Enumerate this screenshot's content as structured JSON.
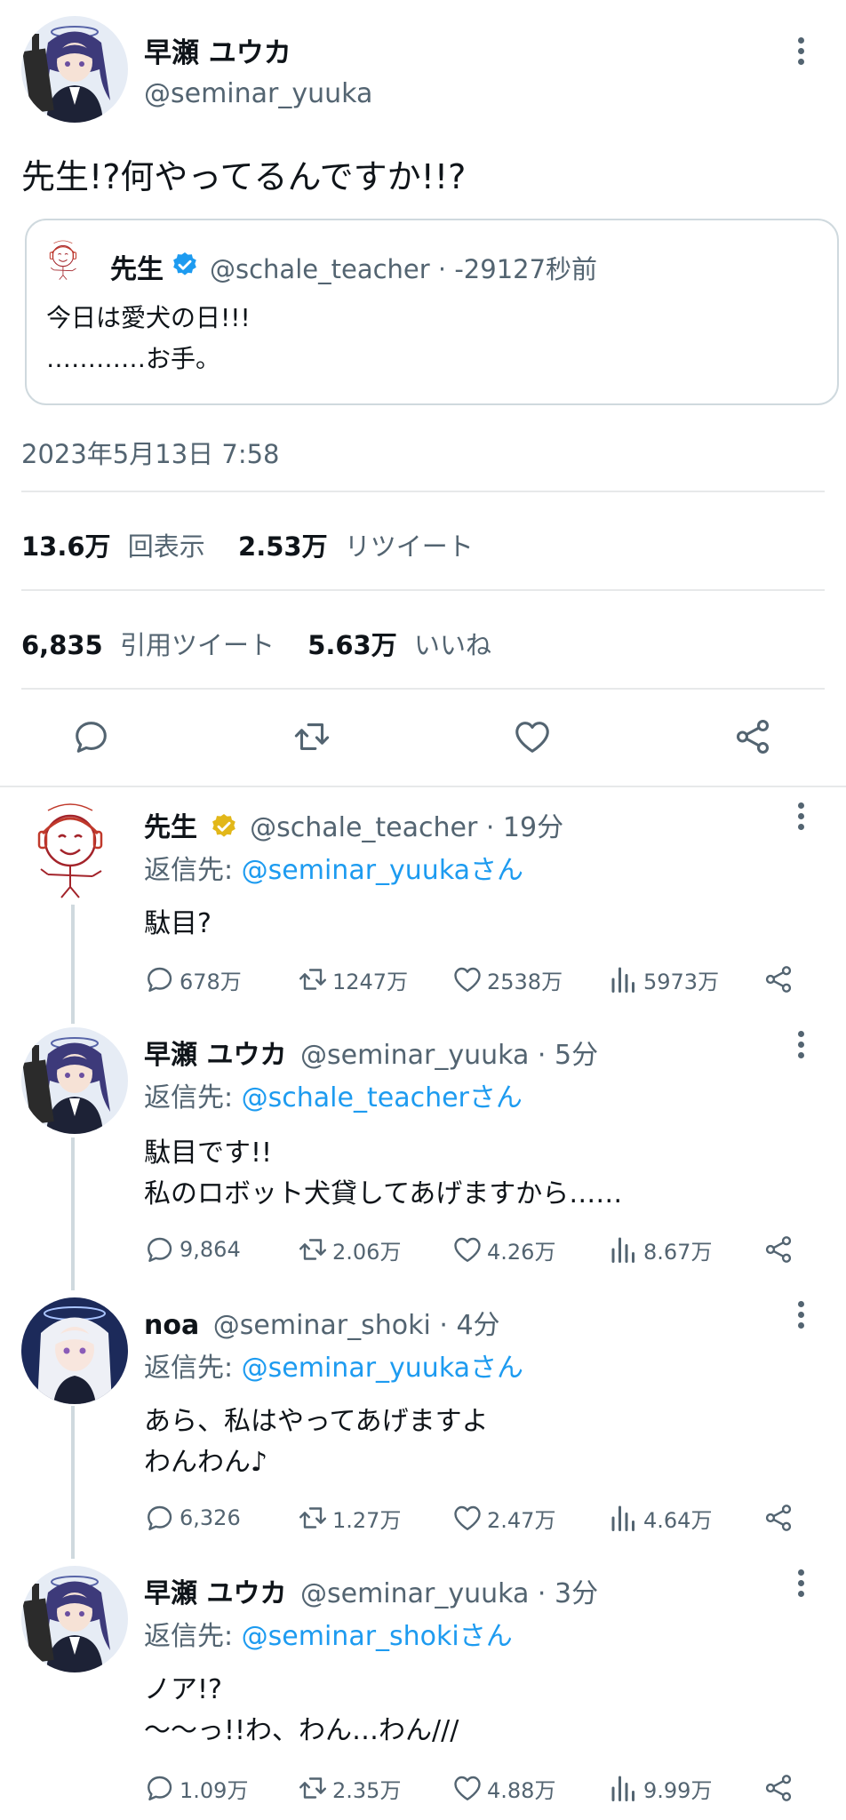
{
  "main_tweet": {
    "display_name": "早瀬 ユウカ",
    "handle": "@seminar_yuuka",
    "text": "先生!?何やってるんですか!!?",
    "quote": {
      "display_name": "先生",
      "handle_time": "@schale_teacher · -29127秒前",
      "line1": "今日は愛犬の日!!!",
      "line2": "…………お手。"
    },
    "timestamp": "2023年5月13日 7:58",
    "stats": {
      "views_num": "13.6万",
      "views_label": "回表示",
      "retweets_num": "2.53万",
      "retweets_label": "リツイート",
      "quotes_num": "6,835",
      "quotes_label": "引用ツイート",
      "likes_num": "5.63万",
      "likes_label": "いいね"
    }
  },
  "replies": [
    {
      "display_name": "先生",
      "handle_time": "@schale_teacher · 19分",
      "reply_prefix": "返信先: ",
      "reply_to": "@seminar_yuukaさん",
      "line1": "駄目?",
      "line2": "",
      "replies": "678万",
      "retweets": "1247万",
      "likes": "2538万",
      "views": "5973万"
    },
    {
      "display_name": "早瀬 ユウカ",
      "handle_time": "@seminar_yuuka · 5分",
      "reply_prefix": "返信先: ",
      "reply_to": "@schale_teacherさん",
      "line1": "駄目です!!",
      "line2": "私のロボット犬貸してあげますから……",
      "replies": "9,864",
      "retweets": "2.06万",
      "likes": "4.26万",
      "views": "8.67万"
    },
    {
      "display_name": "noa",
      "handle_time": "@seminar_shoki · 4分",
      "reply_prefix": "返信先: ",
      "reply_to": "@seminar_yuukaさん",
      "line1": "あら、私はやってあげますよ",
      "line2": "わんわん♪",
      "replies": "6,326",
      "retweets": "1.27万",
      "likes": "2.47万",
      "views": "4.64万"
    },
    {
      "display_name": "早瀬 ユウカ",
      "handle_time": "@seminar_yuuka · 3分",
      "reply_prefix": "返信先: ",
      "reply_to": "@seminar_shokiさん",
      "line1": "ノア!?",
      "line2": "〜〜っ!!わ、わん…わん///",
      "replies": "1.09万",
      "retweets": "2.35万",
      "likes": "4.88万",
      "views": "9.99万"
    }
  ],
  "colors": {
    "accent": "#1d9bf0",
    "text": "#0f1419",
    "muted": "#536471",
    "divider": "#e7e9ea",
    "verified_gold": "#e2b719"
  },
  "icons": [
    "reply-icon",
    "retweet-icon",
    "like-icon",
    "share-icon",
    "views-icon",
    "verified-badge-icon",
    "more-icon"
  ]
}
